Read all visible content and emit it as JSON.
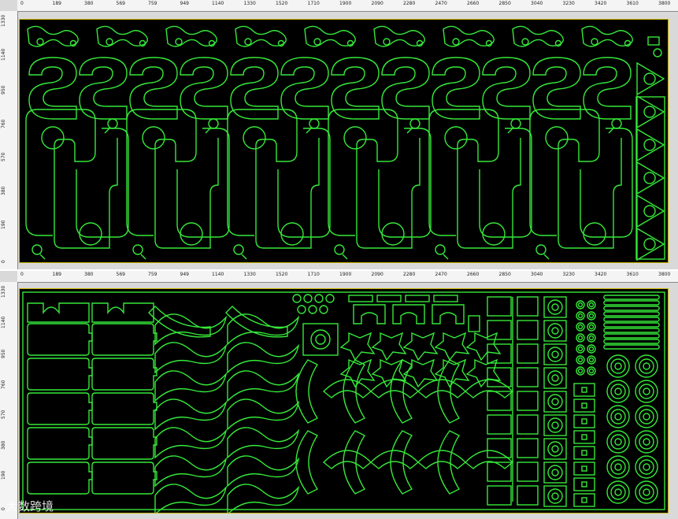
{
  "rulers": {
    "x_ticks": [
      "0",
      "189",
      "380",
      "569",
      "759",
      "949",
      "1140",
      "1330",
      "1520",
      "1710",
      "1900",
      "2090",
      "2280",
      "2470",
      "2660",
      "2850",
      "3040",
      "3230",
      "3420",
      "3610",
      "3800"
    ],
    "y_ticks": [
      "0",
      "190",
      "380",
      "570",
      "760",
      "950",
      "1140",
      "1330"
    ]
  },
  "panels": [
    {
      "name": "nesting-layout-top"
    },
    {
      "name": "nesting-layout-bottom"
    }
  ],
  "watermark": "大数跨境",
  "colors": {
    "part_outline": "#36e83a",
    "sheet_border": "#c8b400",
    "background": "#000000"
  }
}
